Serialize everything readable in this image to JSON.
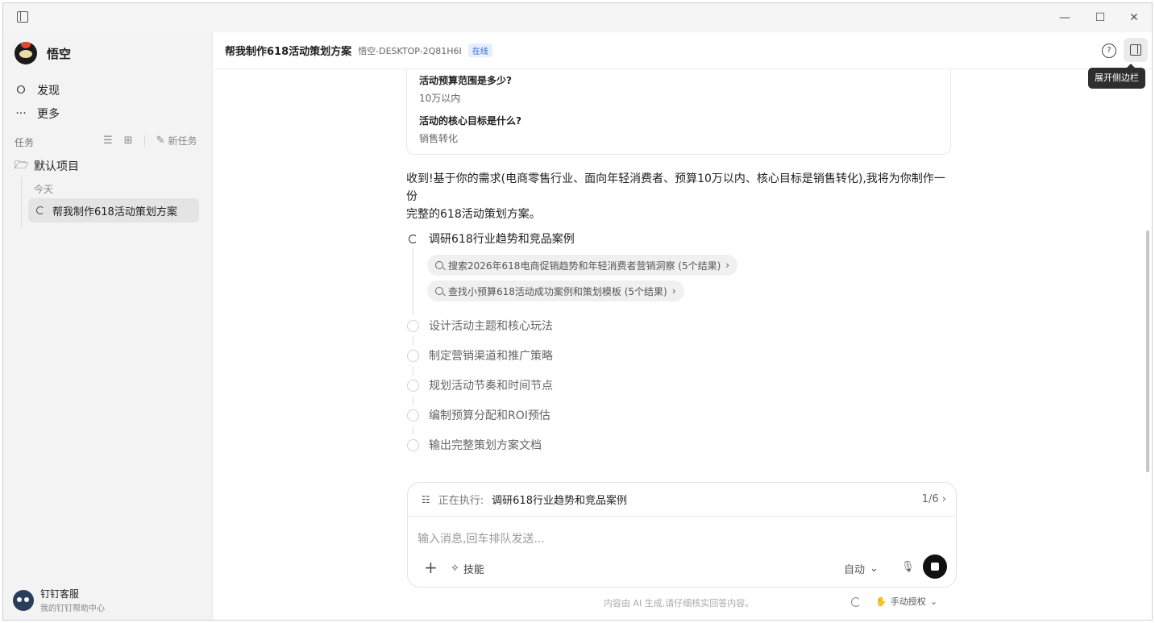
{
  "window": {
    "minimize": "—",
    "maximize": "☐",
    "close": "✕"
  },
  "sidebar": {
    "brand": "悟空",
    "nav": [
      {
        "label": "发现",
        "icon": "planet-icon",
        "glyph": "⭘"
      },
      {
        "label": "更多",
        "icon": "more-icon",
        "glyph": "···"
      }
    ],
    "tasks_label": "任务",
    "new_task_label": "新任务",
    "project": "默认项目",
    "today_label": "今天",
    "task_item": "帮我制作618活动策划方案",
    "support": {
      "name": "钉钉客服",
      "subtitle": "我的钉钉帮助中心"
    }
  },
  "header": {
    "title": "帮我制作618活动策划方案",
    "device": "悟空-DESKTOP-2Q81H6I",
    "status": "在线",
    "tooltip": "展开侧边栏"
  },
  "qa": [
    {
      "question": "活动预算范围是多少?",
      "answer": "10万以内"
    },
    {
      "question": "活动的核心目标是什么?",
      "answer": "销售转化"
    }
  ],
  "reply": {
    "line1": "收到!基于你的需求(电商零售行业、面向年轻消费者、预算10万以内、核心目标是销售转化),我将为你制作一份",
    "line2": "完整的618活动策划方案。"
  },
  "steps": [
    {
      "label": "调研618行业趋势和竞品案例",
      "state": "active"
    },
    {
      "label": "设计活动主题和核心玩法",
      "state": "pending"
    },
    {
      "label": "制定营销渠道和推广策略",
      "state": "pending"
    },
    {
      "label": "规划活动节奏和时间节点",
      "state": "pending"
    },
    {
      "label": "编制预算分配和ROI预估",
      "state": "pending"
    },
    {
      "label": "输出完整策划方案文档",
      "state": "pending"
    }
  ],
  "searches": [
    "搜索2026年618电商促销趋势和年轻消费者营销洞察 (5个结果)",
    "查找小预算618活动成功案例和策划模板 (5个结果)"
  ],
  "composer": {
    "exec_label": "正在执行:",
    "exec_task": "调研618行业趋势和竞品案例",
    "exec_count": "1/6",
    "placeholder": "输入消息,回车排队发送...",
    "skills_label": "技能",
    "mode": "自动"
  },
  "footer": {
    "disclaimer": "内容由 AI 生成,请仔细核实回答内容。",
    "auth": "手动授权"
  }
}
